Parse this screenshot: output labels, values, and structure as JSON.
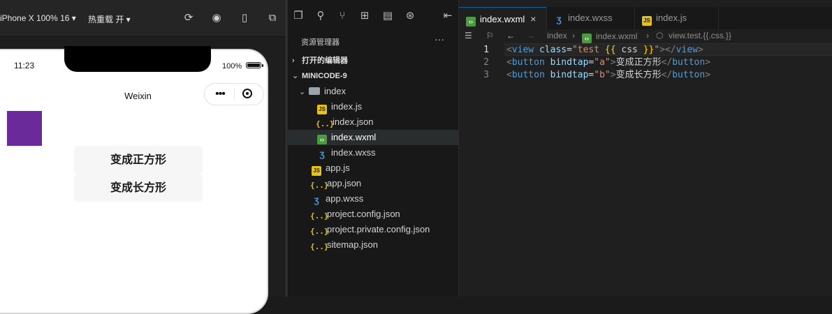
{
  "simulator": {
    "toolbar": {
      "device": "iPhone X 100% 16",
      "hot_reload": "热重载 开"
    },
    "status": {
      "time": "11:23",
      "battery": "100%"
    },
    "nav_title": "Weixin",
    "capsule_dots": "•••",
    "buttons": [
      "变成正方形",
      "变成长方形"
    ],
    "colors": {
      "purple_box": "#6a2a9a"
    }
  },
  "explorer": {
    "title": "资源管理器",
    "more": "···",
    "open_editors": "打开的编辑器",
    "project": "MINICODE-9",
    "folder": "index",
    "folder_files": [
      {
        "name": "index.js",
        "icon": "js"
      },
      {
        "name": "index.json",
        "icon": "json"
      },
      {
        "name": "index.wxml",
        "icon": "wxml"
      },
      {
        "name": "index.wxss",
        "icon": "wxss"
      }
    ],
    "root_files": [
      {
        "name": "app.js",
        "icon": "js"
      },
      {
        "name": "app.json",
        "icon": "json"
      },
      {
        "name": "app.wxss",
        "icon": "wxss"
      },
      {
        "name": "project.config.json",
        "icon": "json"
      },
      {
        "name": "project.private.config.json",
        "icon": "json"
      },
      {
        "name": "sitemap.json",
        "icon": "json"
      }
    ],
    "selected": "index.wxml"
  },
  "editor": {
    "tabs": [
      {
        "label": "index.wxml",
        "active": true,
        "icon": "wxml"
      },
      {
        "label": "index.wxss",
        "active": false,
        "icon": "wxss"
      },
      {
        "label": "index.js",
        "active": false,
        "icon": "js"
      }
    ],
    "breadcrumb": {
      "folder": "index",
      "file": "index.wxml",
      "symbol": "view.test.{{.css.}}"
    },
    "line_numbers": [
      "1",
      "2",
      "3"
    ],
    "code": {
      "l1": {
        "open_lt": "<",
        "tag": "view",
        "attr": "class",
        "eq": "=",
        "q1": "\"test ",
        "br_open": "{{",
        "expr": " css ",
        "br_close": "}}",
        "q2": "\"",
        "close": "></",
        "tag_end": "view",
        "gt": ">"
      },
      "l2": {
        "open_lt": "<",
        "tag": "button",
        "attr": "bindtap",
        "eq": "=",
        "val": "\"a\"",
        "gt1": ">",
        "text": "变成正方形",
        "close": "</",
        "tag_end": "button",
        "gt2": ">"
      },
      "l3": {
        "open_lt": "<",
        "tag": "button",
        "attr": "bindtap",
        "eq": "=",
        "val": "\"b\"",
        "gt1": ">",
        "text": "变成长方形",
        "close": "</",
        "tag_end": "button",
        "gt2": ">"
      }
    }
  }
}
